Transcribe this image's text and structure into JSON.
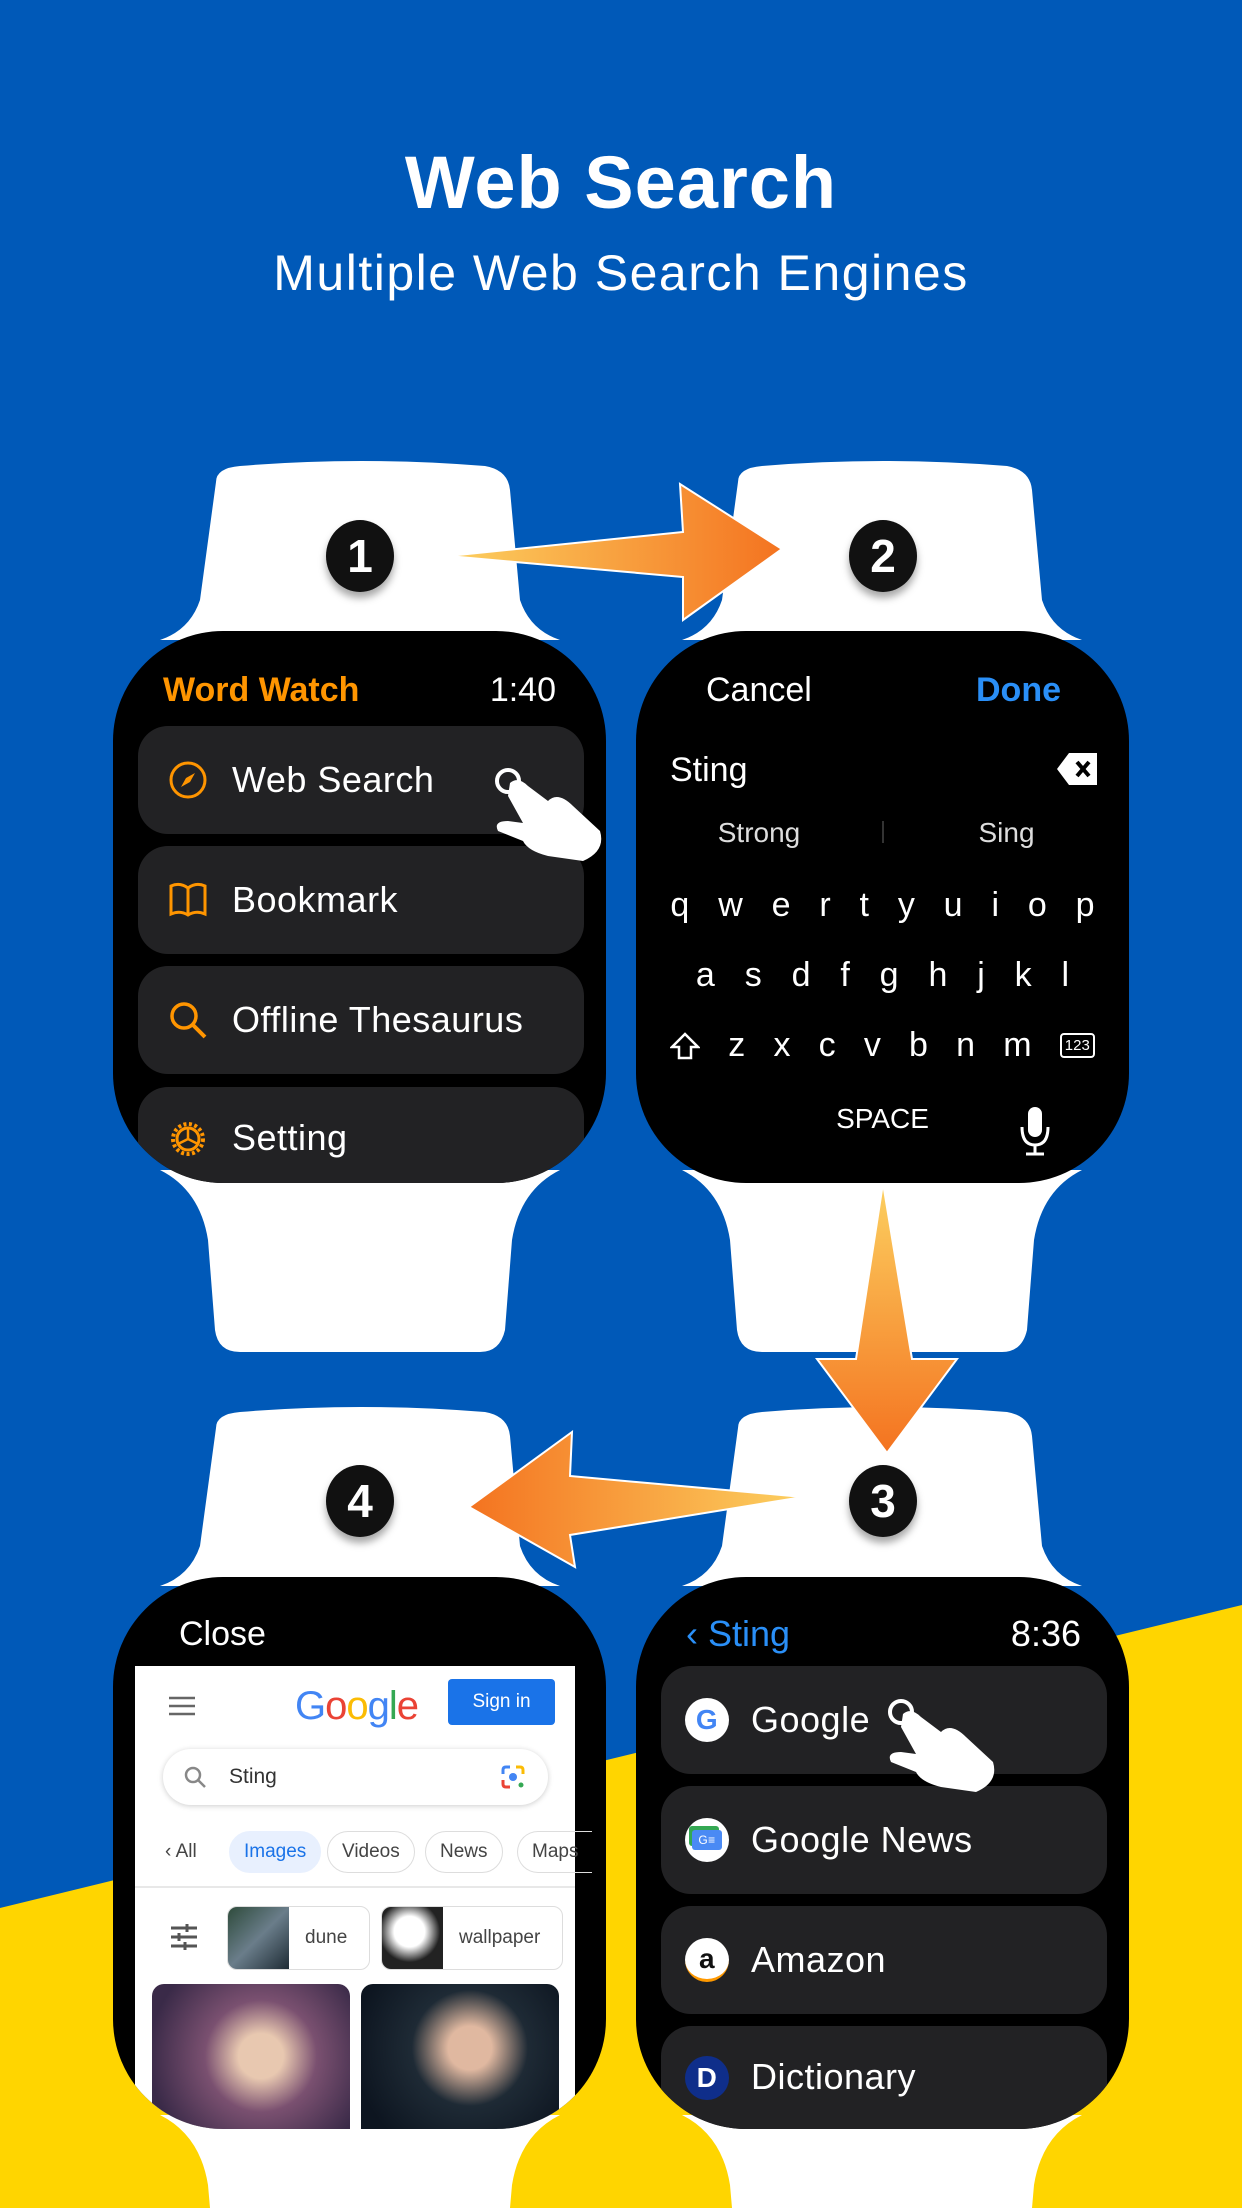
{
  "header": {
    "title": "Web Search",
    "subtitle": "Multiple Web Search Engines"
  },
  "colors": {
    "background_blue": "#0059b8",
    "background_yellow": "#ffd500",
    "accent_orange": "#ff9500",
    "link_blue": "#2a8ff7",
    "arrow_start": "#fcd060",
    "arrow_end": "#f47320"
  },
  "steps": [
    "1",
    "2",
    "3",
    "4"
  ],
  "watch1": {
    "app_title": "Word Watch",
    "time": "1:40",
    "menu": [
      {
        "label": "Web Search",
        "icon": "compass-icon"
      },
      {
        "label": "Bookmark",
        "icon": "book-icon"
      },
      {
        "label": "Offline Thesaurus",
        "icon": "search-icon"
      },
      {
        "label": "Setting",
        "icon": "gear-icon"
      }
    ]
  },
  "watch2": {
    "cancel": "Cancel",
    "done": "Done",
    "input_value": "Sting",
    "suggestions": [
      "Strong",
      "Sing"
    ],
    "keys_row1": [
      "q",
      "w",
      "e",
      "r",
      "t",
      "y",
      "u",
      "i",
      "o",
      "p"
    ],
    "keys_row2": [
      "a",
      "s",
      "d",
      "f",
      "g",
      "h",
      "j",
      "k",
      "l"
    ],
    "keys_row3": [
      "z",
      "x",
      "c",
      "v",
      "b",
      "n",
      "m"
    ],
    "numbers_key": "123",
    "space": "SPACE"
  },
  "watch3": {
    "back_label": "Sting",
    "time": "8:36",
    "engines": [
      {
        "label": "Google",
        "icon": "google-icon"
      },
      {
        "label": "Google News",
        "icon": "google-news-icon"
      },
      {
        "label": "Amazon",
        "icon": "amazon-icon"
      },
      {
        "label": "Dictionary",
        "icon": "dictionary-icon"
      }
    ]
  },
  "watch4": {
    "close": "Close",
    "sign_in": "Sign in",
    "search_value": "Sting",
    "tabs": [
      "All",
      "Images",
      "Videos",
      "News",
      "Maps"
    ],
    "active_tab": "Images",
    "chips": [
      "dune",
      "wallpaper"
    ]
  }
}
